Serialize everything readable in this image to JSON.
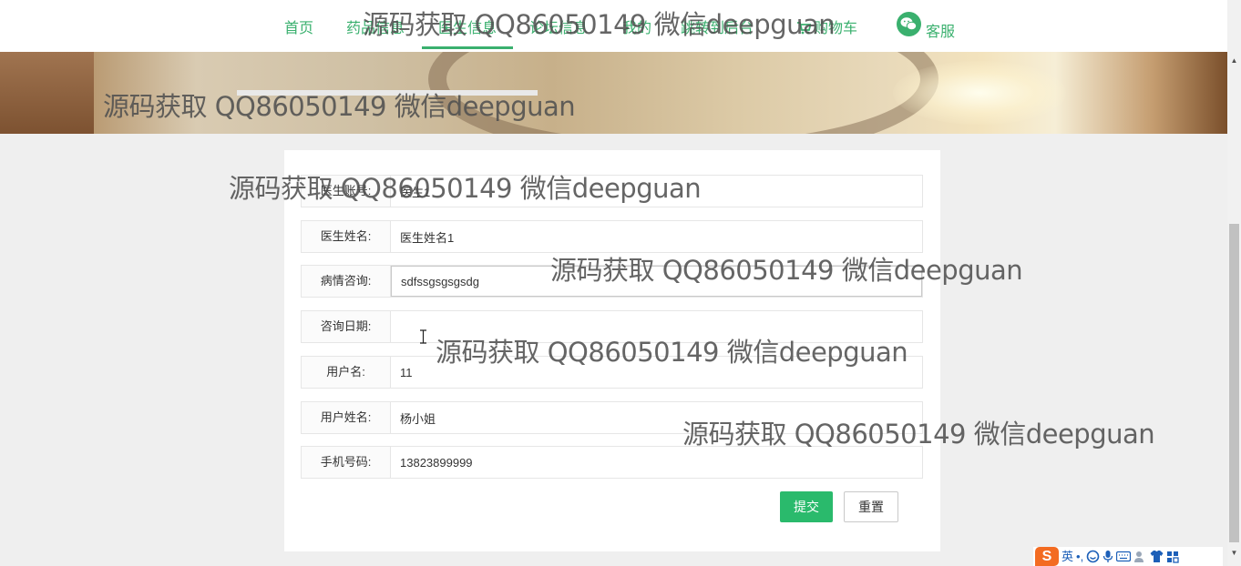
{
  "nav": {
    "items": [
      {
        "label": "首页"
      },
      {
        "label": "药品信息"
      },
      {
        "label": "医生信息"
      },
      {
        "label": "论坛信息"
      },
      {
        "label": "我的"
      },
      {
        "label": "跳转到后台"
      },
      {
        "label": "购物车"
      },
      {
        "label": "客服"
      }
    ],
    "active": "医生信息"
  },
  "form": {
    "fields": [
      {
        "label": "医生账号:",
        "value": "医生1"
      },
      {
        "label": "医生姓名:",
        "value": "医生姓名1"
      },
      {
        "label": "病情咨询:",
        "value": "sdfssgsgsgsdg"
      },
      {
        "label": "咨询日期:",
        "value": ""
      },
      {
        "label": "用户名:",
        "value": "11"
      },
      {
        "label": "用户姓名:",
        "value": "杨小姐"
      },
      {
        "label": "手机号码:",
        "value": "13823899999"
      }
    ],
    "submit_label": "提交",
    "reset_label": "重置"
  },
  "watermark": "源码获取 QQ86050149 微信deepguan",
  "ime": {
    "logo": "S",
    "lang": "英",
    "punct": "•,"
  },
  "colors": {
    "accent": "#3ab06e",
    "submit": "#2aba6c"
  }
}
